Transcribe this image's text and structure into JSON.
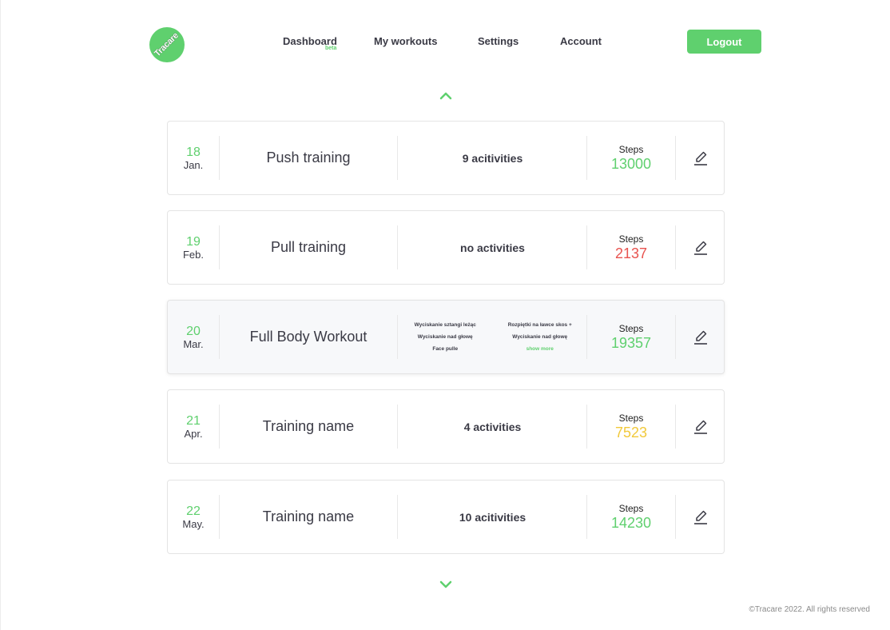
{
  "logo": {
    "text": "Tracare",
    "icon": "tracare-logo-icon"
  },
  "nav": {
    "items": [
      {
        "label": "Dashboard",
        "badge": "beta"
      },
      {
        "label": "My workouts"
      },
      {
        "label": "Settings"
      },
      {
        "label": "Account"
      }
    ],
    "logout_label": "Logout"
  },
  "colors": {
    "accent": "#5fd06e",
    "steps_good": "#5fd06e",
    "steps_bad": "#e8534f",
    "steps_mid": "#f1c93b"
  },
  "icons": {
    "scroll_up": "chevron-up-icon",
    "scroll_down": "chevron-down-icon",
    "edit": "pencil-icon"
  },
  "workouts": [
    {
      "day": "18",
      "month": "Jan.",
      "name": "Push training",
      "activities": "9 acitivities",
      "steps_label": "Steps",
      "steps": "13000",
      "steps_status": "good"
    },
    {
      "day": "19",
      "month": "Feb.",
      "name": "Pull training",
      "activities": "no activities",
      "steps_label": "Steps",
      "steps": "2137",
      "steps_status": "bad"
    },
    {
      "day": "20",
      "month": "Mar.",
      "name": "Full Body Workout",
      "activity_list": [
        "Wyciskanie sztangi leżąc",
        "Rozpiętki na ławce skos +",
        "Wyciskanie nad głowę",
        "Wyciskanie nad głowę",
        "Face pulle"
      ],
      "show_more": "show more",
      "steps_label": "Steps",
      "steps": "19357",
      "steps_status": "good"
    },
    {
      "day": "21",
      "month": "Apr.",
      "name": "Training name",
      "activities": "4 activities",
      "steps_label": "Steps",
      "steps": "7523",
      "steps_status": "mid"
    },
    {
      "day": "22",
      "month": "May.",
      "name": "Training name",
      "activities": "10 acitivities",
      "steps_label": "Steps",
      "steps": "14230",
      "steps_status": "good"
    }
  ],
  "footer": {
    "copyright": "©Tracare  2022. All rights reserved"
  }
}
